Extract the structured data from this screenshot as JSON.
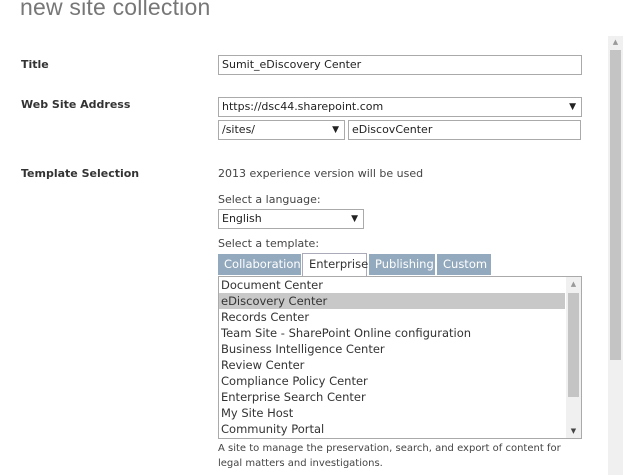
{
  "page_title": "new site collection",
  "fields": {
    "title_label": "Title",
    "title_value": "Sumit_eDiscovery Center",
    "address_label": "Web Site Address",
    "domain_value": "https://dsc44.sharepoint.com",
    "path_value": "/sites/",
    "url_name_value": "eDiscovCenter",
    "template_label": "Template Selection",
    "experience_note": "2013 experience version will be used",
    "language_label": "Select a language:",
    "language_value": "English",
    "template_prompt": "Select a template:"
  },
  "tabs": [
    {
      "label": "Collaboration"
    },
    {
      "label": "Enterprise"
    },
    {
      "label": "Publishing"
    },
    {
      "label": "Custom"
    }
  ],
  "templates": [
    "Document Center",
    "eDiscovery Center",
    "Records Center",
    "Team Site - SharePoint Online configuration",
    "Business Intelligence Center",
    "Review Center",
    "Compliance Policy Center",
    "Enterprise Search Center",
    "My Site Host",
    "Community Portal"
  ],
  "selected_template": "eDiscovery Center",
  "description": "A site to manage the preservation, search, and export of content for legal matters and investigations.",
  "icons": {
    "dropdown": "▼",
    "scroll_up": "▲",
    "scroll_down": "▼"
  }
}
